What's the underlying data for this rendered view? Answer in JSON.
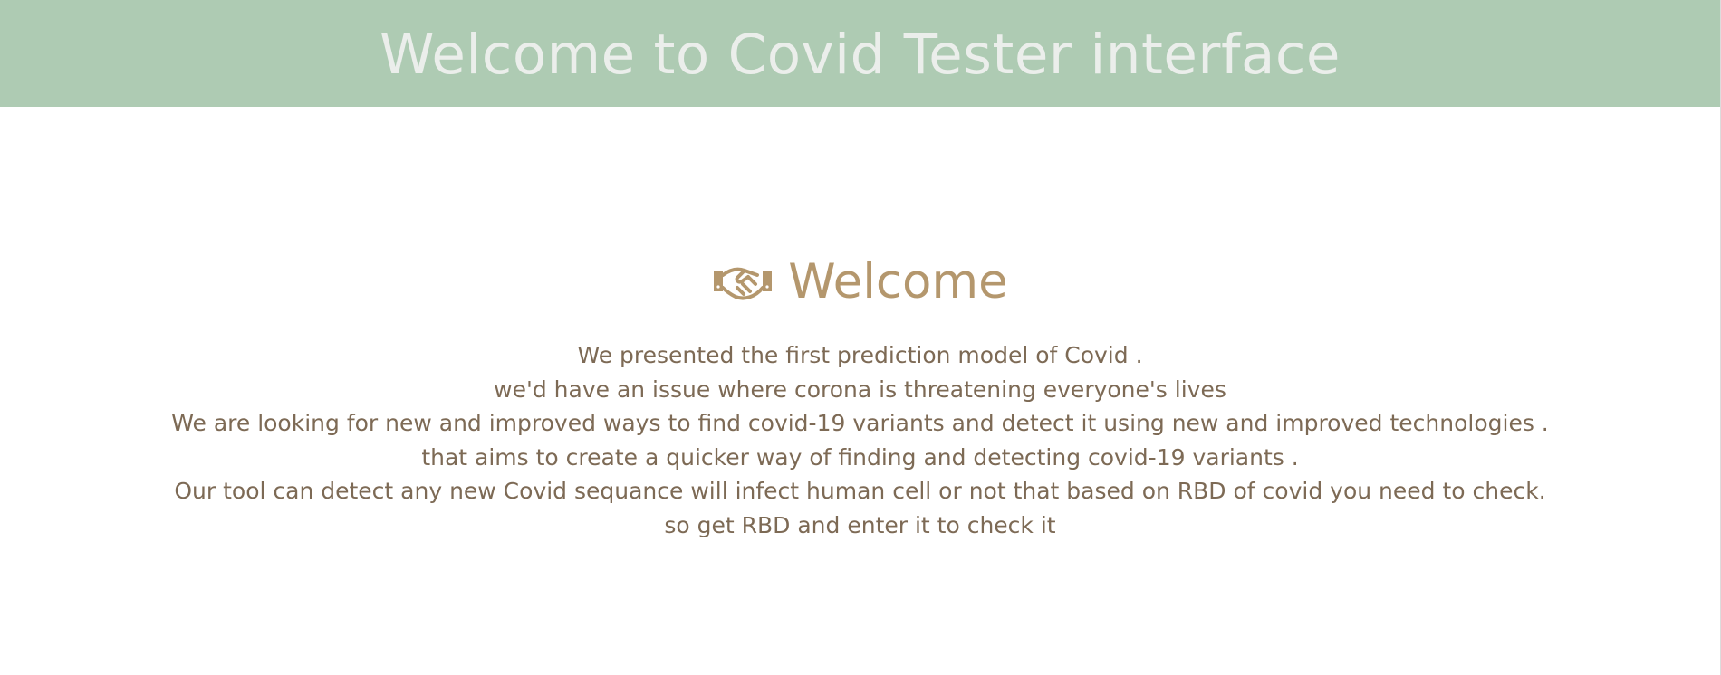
{
  "header": {
    "title": "Welcome to Covid Tester interface"
  },
  "welcome": {
    "icon": "handshake-icon",
    "heading": "Welcome",
    "lines": [
      "We presented the first prediction model of Covid .",
      "we'd have an issue where corona is threatening everyone's lives",
      "We are looking for new and improved ways to find covid-19 variants and detect it using new and improved technologies .",
      "that aims to create a quicker way of finding and detecting covid-19 variants .",
      "Our tool can detect any new Covid sequance will infect human cell or not that based on RBD of covid you need to check.",
      "so get RBD and enter it to check it"
    ]
  },
  "colors": {
    "banner_background": "#aecbb3",
    "banner_text": "#ebeeeb",
    "heading_accent": "#b4976d",
    "body_text": "#7d6a55"
  }
}
